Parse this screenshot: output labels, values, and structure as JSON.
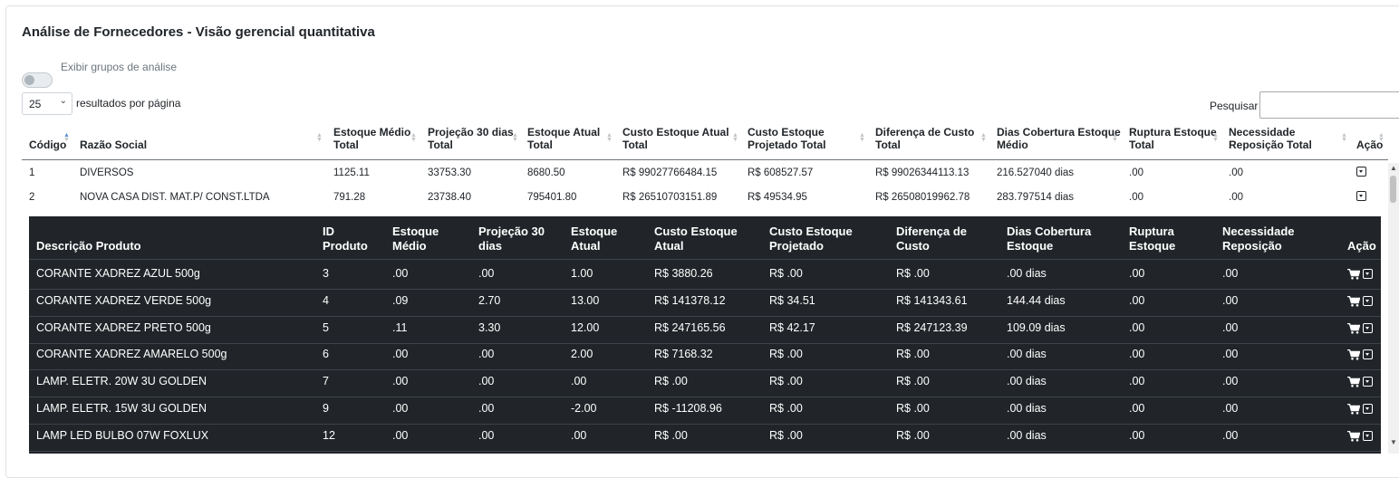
{
  "page": {
    "title": "Análise de Fornecedores - Visão gerencial quantitativa",
    "toggle_label": "Exibir grupos de análise",
    "per_page_value": "25",
    "per_page_label": "resultados por página",
    "search_label": "Pesquisar",
    "search_value": ""
  },
  "main_table": {
    "headers": [
      {
        "l1": "Código",
        "l2": ""
      },
      {
        "l1": "Razão Social",
        "l2": ""
      },
      {
        "l1": "Estoque Médio",
        "l2": "Total"
      },
      {
        "l1": "Projeção 30 dias",
        "l2": "Total"
      },
      {
        "l1": "Estoque Atual",
        "l2": "Total"
      },
      {
        "l1": "Custo Estoque Atual",
        "l2": "Total"
      },
      {
        "l1": "Custo Estoque",
        "l2": "Projetado Total"
      },
      {
        "l1": "Diferença de Custo",
        "l2": "Total"
      },
      {
        "l1": "Dias Cobertura Estoque",
        "l2": "Médio"
      },
      {
        "l1": "Ruptura Estoque",
        "l2": "Total"
      },
      {
        "l1": "Necessidade",
        "l2": "Reposição Total"
      },
      {
        "l1": "Ação",
        "l2": ""
      }
    ],
    "rows": [
      [
        "1",
        "DIVERSOS",
        "1125.11",
        "33753.30",
        "8680.50",
        "R$ 99027766484.15",
        "R$ 608527.57",
        "R$ 99026344113.13",
        "216.527040 dias",
        ".00",
        ".00"
      ],
      [
        "2",
        "NOVA CASA DIST. MAT.P/ CONST.LTDA",
        "791.28",
        "23738.40",
        "795401.80",
        "R$ 26510703151.89",
        "R$ 49534.95",
        "R$ 26508019962.78",
        "283.797514 dias",
        ".00",
        ".00"
      ]
    ]
  },
  "sub_table": {
    "headers": [
      {
        "l1": "Descrição Produto",
        "l2": ""
      },
      {
        "l1": "ID",
        "l2": "Produto"
      },
      {
        "l1": "Estoque",
        "l2": "Médio"
      },
      {
        "l1": "Projeção 30",
        "l2": "dias"
      },
      {
        "l1": "Estoque",
        "l2": "Atual"
      },
      {
        "l1": "Custo Estoque",
        "l2": "Atual"
      },
      {
        "l1": "Custo Estoque",
        "l2": "Projetado"
      },
      {
        "l1": "Diferença de",
        "l2": "Custo"
      },
      {
        "l1": "Dias Cobertura",
        "l2": "Estoque"
      },
      {
        "l1": "Ruptura",
        "l2": "Estoque"
      },
      {
        "l1": "Necessidade",
        "l2": "Reposição"
      },
      {
        "l1": "Ação",
        "l2": ""
      }
    ],
    "rows": [
      [
        "CORANTE XADREZ AZUL 500g",
        "3",
        ".00",
        ".00",
        "1.00",
        "R$ 3880.26",
        "R$ .00",
        "R$ .00",
        ".00 dias",
        ".00",
        ".00"
      ],
      [
        "CORANTE XADREZ VERDE 500g",
        "4",
        ".09",
        "2.70",
        "13.00",
        "R$ 141378.12",
        "R$ 34.51",
        "R$ 141343.61",
        "144.44 dias",
        ".00",
        ".00"
      ],
      [
        "CORANTE XADREZ PRETO 500g",
        "5",
        ".11",
        "3.30",
        "12.00",
        "R$ 247165.56",
        "R$ 42.17",
        "R$ 247123.39",
        "109.09 dias",
        ".00",
        ".00"
      ],
      [
        "CORANTE XADREZ AMARELO 500g",
        "6",
        ".00",
        ".00",
        "2.00",
        "R$ 7168.32",
        "R$ .00",
        "R$ .00",
        ".00 dias",
        ".00",
        ".00"
      ],
      [
        "LAMP. ELETR. 20W 3U GOLDEN",
        "7",
        ".00",
        ".00",
        ".00",
        "R$ .00",
        "R$ .00",
        "R$ .00",
        ".00 dias",
        ".00",
        ".00"
      ],
      [
        "LAMP. ELETR. 15W 3U GOLDEN",
        "9",
        ".00",
        ".00",
        "-2.00",
        "R$ -11208.96",
        "R$ .00",
        "R$ .00",
        ".00 dias",
        ".00",
        ".00"
      ],
      [
        "LAMP LED BULBO 07W FOXLUX",
        "12",
        ".00",
        ".00",
        ".00",
        "R$ .00",
        "R$ .00",
        "R$ .00",
        ".00 dias",
        ".00",
        ".00"
      ]
    ]
  },
  "icons": {
    "cart": "cart-icon",
    "expand": "expand-dropdown-icon"
  }
}
